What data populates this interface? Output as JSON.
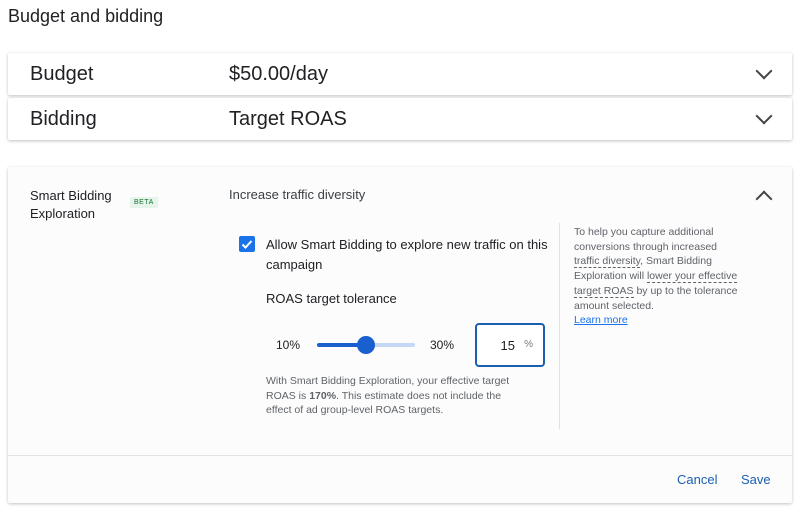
{
  "title": "Budget and bidding",
  "budget": {
    "label": "Budget",
    "value": "$50.00/day"
  },
  "bidding": {
    "label": "Bidding",
    "value": "Target ROAS"
  },
  "exploration": {
    "label": "Smart Bidding Exploration",
    "badge": "BETA",
    "heading": "Increase traffic diversity",
    "checkbox_label": "Allow Smart Bidding to explore new traffic on this campaign",
    "checked": true,
    "tolerance_label": "ROAS target tolerance",
    "slider": {
      "min_label": "10%",
      "max_label": "30%",
      "value": 15,
      "fill_fraction": 0.5
    },
    "input_value": "15",
    "input_unit": "%",
    "note_pre": "With Smart Bidding Exploration, your effective target ROAS is ",
    "note_bold": "170%",
    "note_post": ". This estimate does not include the effect of ad group-level ROAS targets.",
    "side": {
      "t1": "To help you capture additional conversions through increased ",
      "t2": "traffic diversity",
      "t3": ", Smart Bidding Exploration will ",
      "t4": "lower your effective target ROAS",
      "t5": " by up to the tolerance amount selected.",
      "link": "Learn more"
    }
  },
  "actions": {
    "cancel": "Cancel",
    "save": "Save"
  }
}
